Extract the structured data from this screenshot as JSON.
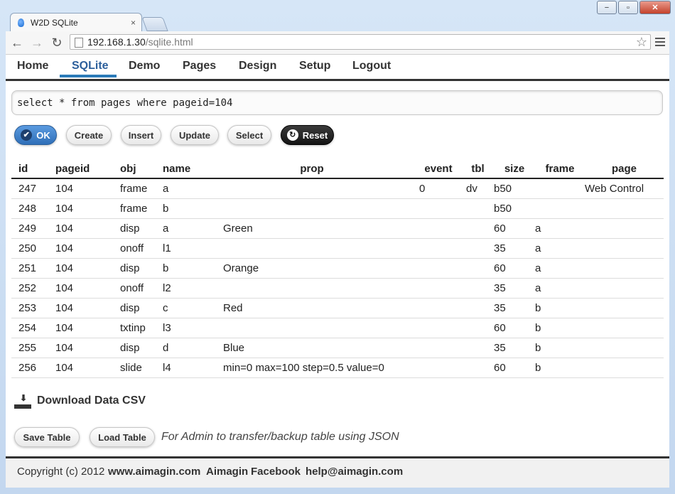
{
  "browser": {
    "tab_title": "W2D SQLite",
    "tab_close": "×",
    "url_host": "192.168.1.30",
    "url_path": "/sqlite.html",
    "back": "←",
    "forward": "→",
    "reload": "↻",
    "star": "☆"
  },
  "window_controls": {
    "minimize": "−",
    "maximize": "▫",
    "close": "✕"
  },
  "nav": {
    "items": [
      "Home",
      "SQLite",
      "Demo",
      "Pages",
      "Design",
      "Setup",
      "Logout"
    ],
    "active": "SQLite"
  },
  "query": "select * from pages where pageid=104",
  "actions": {
    "ok": "OK",
    "create": "Create",
    "insert": "Insert",
    "update": "Update",
    "select": "Select",
    "reset": "Reset"
  },
  "table": {
    "headers": [
      "id",
      "pageid",
      "obj",
      "name",
      "prop",
      "event",
      "tbl",
      "size",
      "frame",
      "page"
    ],
    "rows": [
      [
        "247",
        "104",
        "frame",
        "a",
        "",
        "0",
        "dv",
        "b50",
        "",
        "Web Control"
      ],
      [
        "248",
        "104",
        "frame",
        "b",
        "",
        "",
        "",
        "b50",
        "",
        ""
      ],
      [
        "249",
        "104",
        "disp",
        "a",
        "Green",
        "",
        "",
        "60",
        "a",
        ""
      ],
      [
        "250",
        "104",
        "onoff",
        "l1",
        "",
        "",
        "",
        "35",
        "a",
        ""
      ],
      [
        "251",
        "104",
        "disp",
        "b",
        "Orange",
        "",
        "",
        "60",
        "a",
        ""
      ],
      [
        "252",
        "104",
        "onoff",
        "l2",
        "",
        "",
        "",
        "35",
        "a",
        ""
      ],
      [
        "253",
        "104",
        "disp",
        "c",
        "Red",
        "",
        "",
        "35",
        "b",
        ""
      ],
      [
        "254",
        "104",
        "txtinp",
        "l3",
        "",
        "",
        "",
        "60",
        "b",
        ""
      ],
      [
        "255",
        "104",
        "disp",
        "d",
        "Blue",
        "",
        "",
        "35",
        "b",
        ""
      ],
      [
        "256",
        "104",
        "slide",
        "l4",
        "min=0 max=100 step=0.5 value=0",
        "",
        "",
        "60",
        "b",
        ""
      ]
    ]
  },
  "download": {
    "label": "Download Data CSV",
    "icon": "download-icon"
  },
  "table_actions": {
    "save": "Save Table",
    "load": "Load Table",
    "note": "For Admin to transfer/backup table using JSON"
  },
  "footer": {
    "copyright": "Copyright (c) 2012",
    "site": "www.aimagin.com",
    "company": "Aimagin",
    "facebook": "Facebook",
    "email": "help@aimagin.com"
  },
  "colors": {
    "active_tab_underline": "#2b7bb8",
    "ok_button": "#3a7fcb",
    "reset_button": "#1f1f1f"
  }
}
